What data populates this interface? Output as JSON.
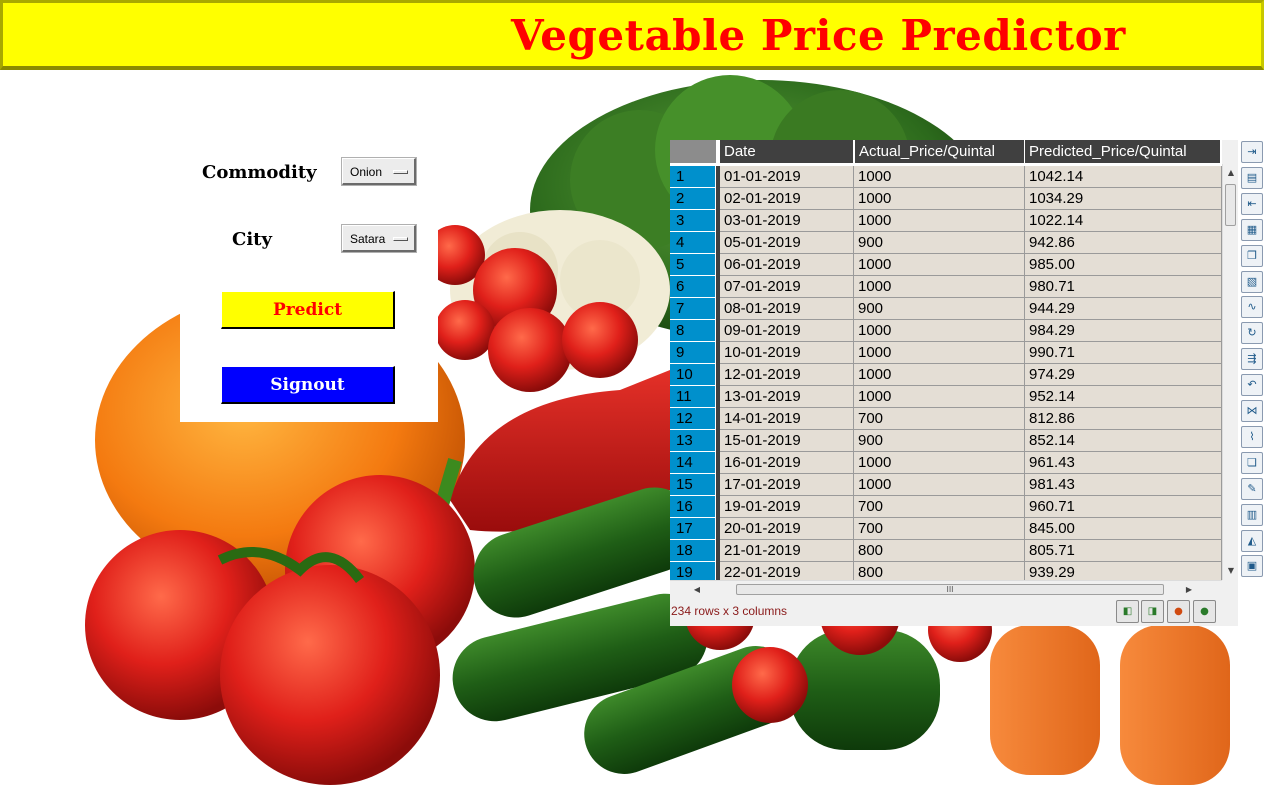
{
  "app": {
    "title": "Vegetable Price Predictor"
  },
  "form": {
    "commodity_label": "Commodity",
    "commodity_value": "Onion",
    "city_label": "City",
    "city_value": "Satara",
    "predict_label": "Predict",
    "signout_label": "Signout"
  },
  "table": {
    "columns": [
      "Date",
      "Actual_Price/Quintal",
      "Predicted_Price/Quintal"
    ],
    "rows": [
      {
        "idx": "1",
        "date": "01-01-2019",
        "actual": "1000",
        "predicted": "1042.14"
      },
      {
        "idx": "2",
        "date": "02-01-2019",
        "actual": "1000",
        "predicted": "1034.29"
      },
      {
        "idx": "3",
        "date": "03-01-2019",
        "actual": "1000",
        "predicted": "1022.14"
      },
      {
        "idx": "4",
        "date": "05-01-2019",
        "actual": "900",
        "predicted": "942.86"
      },
      {
        "idx": "5",
        "date": "06-01-2019",
        "actual": "1000",
        "predicted": "985.00"
      },
      {
        "idx": "6",
        "date": "07-01-2019",
        "actual": "1000",
        "predicted": "980.71"
      },
      {
        "idx": "7",
        "date": "08-01-2019",
        "actual": "900",
        "predicted": "944.29"
      },
      {
        "idx": "8",
        "date": "09-01-2019",
        "actual": "1000",
        "predicted": "984.29"
      },
      {
        "idx": "9",
        "date": "10-01-2019",
        "actual": "1000",
        "predicted": "990.71"
      },
      {
        "idx": "10",
        "date": "12-01-2019",
        "actual": "1000",
        "predicted": "974.29"
      },
      {
        "idx": "11",
        "date": "13-01-2019",
        "actual": "1000",
        "predicted": "952.14"
      },
      {
        "idx": "12",
        "date": "14-01-2019",
        "actual": "700",
        "predicted": "812.86"
      },
      {
        "idx": "13",
        "date": "15-01-2019",
        "actual": "900",
        "predicted": "852.14"
      },
      {
        "idx": "14",
        "date": "16-01-2019",
        "actual": "1000",
        "predicted": "961.43"
      },
      {
        "idx": "15",
        "date": "17-01-2019",
        "actual": "1000",
        "predicted": "981.43"
      },
      {
        "idx": "16",
        "date": "19-01-2019",
        "actual": "700",
        "predicted": "960.71"
      },
      {
        "idx": "17",
        "date": "20-01-2019",
        "actual": "700",
        "predicted": "845.00"
      },
      {
        "idx": "18",
        "date": "21-01-2019",
        "actual": "800",
        "predicted": "805.71"
      },
      {
        "idx": "19",
        "date": "22-01-2019",
        "actual": "800",
        "predicted": "939.29"
      }
    ],
    "status": "234 rows x 3 columns",
    "scroll_grip": "III"
  },
  "toolbar_icons": [
    "export-icon",
    "save-icon",
    "import-icon",
    "excel-icon",
    "copy-icon",
    "paste-icon",
    "plot-icon",
    "refresh-icon",
    "transform-icon",
    "undo-icon",
    "merge-icon",
    "chart-line-icon",
    "duplicate-icon",
    "edit-icon",
    "calculator-icon",
    "chart-area-icon",
    "report-icon"
  ],
  "colors": {
    "title_bar": "#ffff00",
    "title_text": "#ff0000",
    "predict_button": "#ffff00",
    "signout_button": "#0000ff",
    "row_index": "#0090cc",
    "cell_bg": "#e4ded5",
    "header_bg": "#404040"
  }
}
